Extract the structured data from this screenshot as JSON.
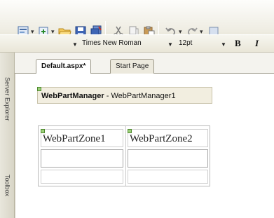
{
  "toolbar": {
    "icons": [
      "solution-icon",
      "add-item-icon",
      "open-folder-icon",
      "save-icon",
      "save-all-icon",
      "cut-icon",
      "copy-icon",
      "paste-icon",
      "undo-icon",
      "redo-icon"
    ]
  },
  "format_toolbar": {
    "font_name": "Times New Roman",
    "font_size": "12pt",
    "bold_label": "B",
    "italic_label": "I"
  },
  "siderail": {
    "server_explorer": "Server Explorer",
    "toolbox": "Toolbox"
  },
  "tabs": {
    "active": "Default.aspx*",
    "inactive": "Start Page"
  },
  "design": {
    "wpm_type": "WebPartManager",
    "wpm_sep": " - ",
    "wpm_id": "WebPartManager1",
    "zone1": "WebPartZone1",
    "zone2": "WebPartZone2"
  }
}
